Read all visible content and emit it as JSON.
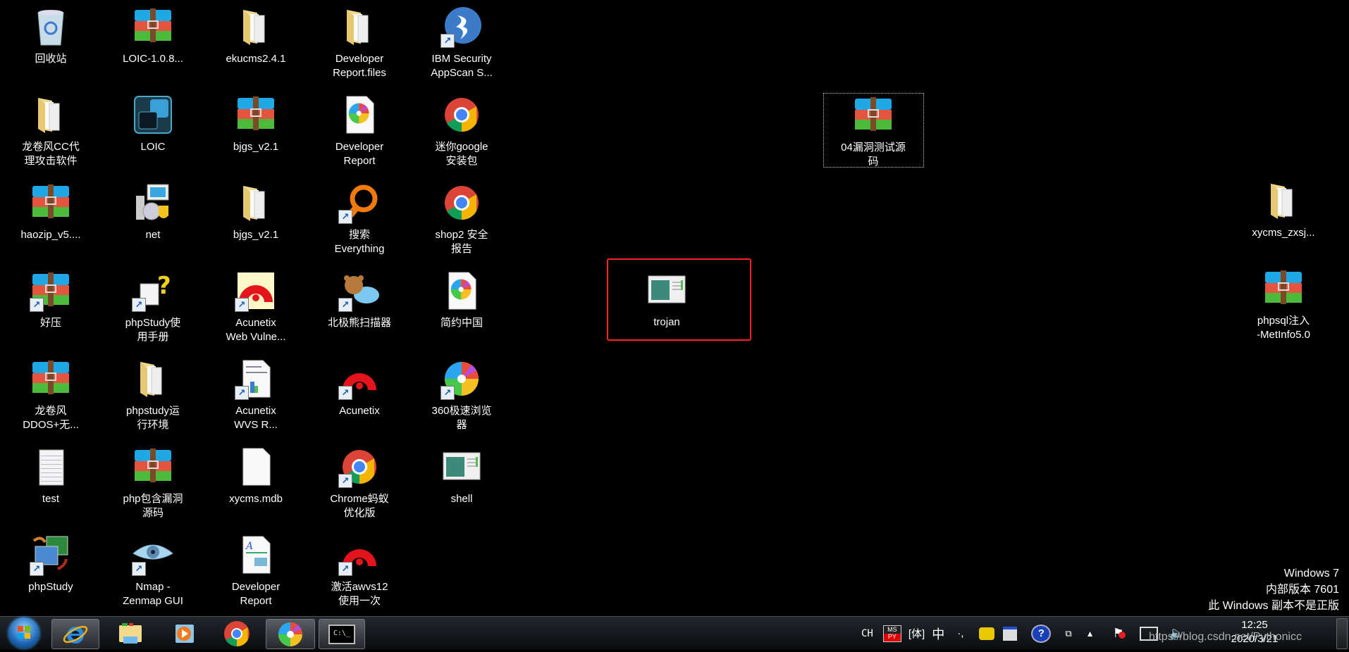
{
  "desktop": {
    "grid_icons": [
      {
        "label": "回收站",
        "icon": "recycle-bin"
      },
      {
        "label": "LOIC-1.0.8...",
        "icon": "winrar-archive"
      },
      {
        "label": "ekucms2.4.1",
        "icon": "folder"
      },
      {
        "label": "Developer\nReport.files",
        "icon": "folder"
      },
      {
        "label": "IBM Security\nAppScan S...",
        "icon": "appscan",
        "shortcut": true
      },
      {
        "label": "龙卷风CC代\n理攻击软件",
        "icon": "folder"
      },
      {
        "label": "LOIC",
        "icon": "loic"
      },
      {
        "label": "bjgs_v2.1",
        "icon": "winrar-archive"
      },
      {
        "label": "Developer\nReport",
        "icon": "browser-360-doc"
      },
      {
        "label": "迷你google\n安装包",
        "icon": "chrome-installer"
      },
      {
        "label": "haozip_v5....",
        "icon": "installer-box"
      },
      {
        "label": "net",
        "icon": "setup"
      },
      {
        "label": "bjgs_v2.1",
        "icon": "folder"
      },
      {
        "label": "搜索\nEverything",
        "icon": "everything",
        "shortcut": true
      },
      {
        "label": "shop2 安全\n报告",
        "icon": "chrome"
      },
      {
        "label": "好压",
        "icon": "winrar-archive",
        "shortcut": true
      },
      {
        "label": "phpStudy使\n用手册",
        "icon": "help-doc",
        "shortcut": true
      },
      {
        "label": "Acunetix\nWeb Vulne...",
        "icon": "acunetix-box",
        "shortcut": true
      },
      {
        "label": "北极熊扫描器",
        "icon": "bear",
        "shortcut": true
      },
      {
        "label": "简约中国",
        "icon": "browser-360-doc"
      },
      {
        "label": "龙卷风\nDDOS+无...",
        "icon": "winrar-archive"
      },
      {
        "label": "phpstudy运\n行环境",
        "icon": "folder"
      },
      {
        "label": "Acunetix\nWVS R...",
        "icon": "report-doc",
        "shortcut": true
      },
      {
        "label": "Acunetix",
        "icon": "acunetix",
        "shortcut": true
      },
      {
        "label": "360极速浏览\n器",
        "icon": "browser-360",
        "shortcut": true
      },
      {
        "label": "test",
        "icon": "text-file"
      },
      {
        "label": "php包含漏洞\n源码",
        "icon": "winrar-archive"
      },
      {
        "label": "xycms.mdb",
        "icon": "blank-file"
      },
      {
        "label": "Chrome蚂蚁\n优化版",
        "icon": "chrome",
        "shortcut": true
      },
      {
        "label": "shell",
        "icon": "app-window"
      },
      {
        "label": "phpStudy",
        "icon": "phpstudy",
        "shortcut": true
      },
      {
        "label": "Nmap -\nZenmap GUI",
        "icon": "nmap-eye",
        "shortcut": true
      },
      {
        "label": "Developer\nReport",
        "icon": "word-doc"
      },
      {
        "label": "激活awvs12\n使用一次",
        "icon": "acunetix",
        "shortcut": true
      }
    ],
    "selected_icon": {
      "label": "04漏洞测试源\n码",
      "icon": "winrar-archive"
    },
    "highlighted_icon": {
      "label": "trojan",
      "icon": "app-window",
      "highlight_color": "#ff2020"
    },
    "right_icons": [
      {
        "label": "xycms_zxsj...",
        "icon": "folder"
      },
      {
        "label": "phpsql注入\n-MetInfo5.0",
        "icon": "winrar-archive"
      }
    ]
  },
  "watermark": {
    "line1": "Windows 7",
    "line2": "内部版本 7601",
    "line3": "此 Windows 副本不是正版"
  },
  "taskbar": {
    "buttons": [
      {
        "name": "start",
        "icon": "windows-orb"
      },
      {
        "name": "internet-explorer",
        "icon": "ie",
        "active": true
      },
      {
        "name": "windows-explorer",
        "icon": "folder-library"
      },
      {
        "name": "media-player",
        "icon": "media-player"
      },
      {
        "name": "chrome",
        "icon": "chrome"
      },
      {
        "name": "360-browser",
        "icon": "browser-360",
        "active": true
      },
      {
        "name": "command-prompt",
        "icon": "cmd",
        "active": true,
        "text": "C:\\_"
      }
    ],
    "tray": {
      "lang": "CH",
      "ime_label": "中",
      "ime_punct": "·,",
      "clock_time": "12:25",
      "clock_date": "2020/3/21"
    }
  },
  "overlay_url": "https://blog.csdn.net/Pythonicc"
}
